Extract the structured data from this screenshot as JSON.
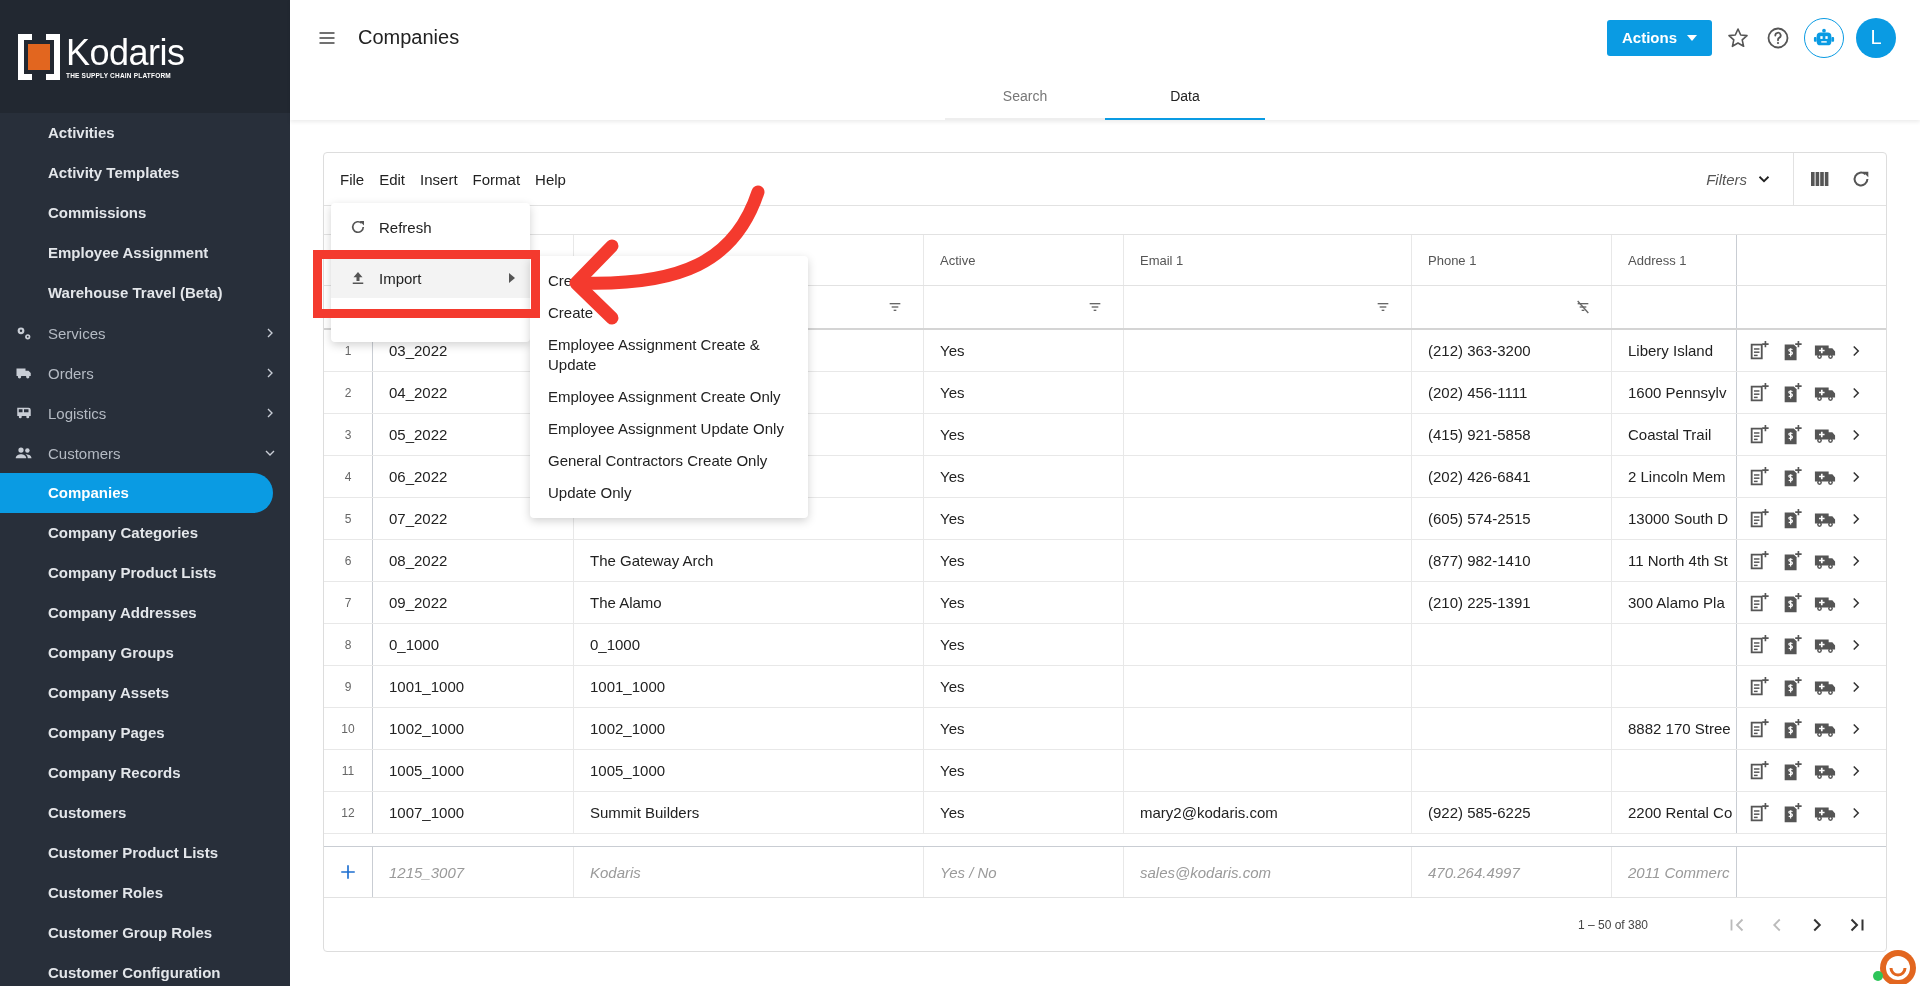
{
  "sidebar": {
    "logo": {
      "name": "Kodaris",
      "tagline": "THE SUPPLY CHAIN PLATFORM"
    },
    "items": [
      {
        "label": "Activities",
        "kind": "link",
        "selected": false
      },
      {
        "label": "Activity Templates",
        "kind": "link",
        "selected": false
      },
      {
        "label": "Commissions",
        "kind": "link",
        "selected": false
      },
      {
        "label": "Employee Assignment",
        "kind": "link",
        "selected": false
      },
      {
        "label": "Warehouse Travel (Beta)",
        "kind": "link",
        "selected": false
      },
      {
        "label": "Services",
        "kind": "group",
        "expanded": false
      },
      {
        "label": "Orders",
        "kind": "group",
        "expanded": false
      },
      {
        "label": "Logistics",
        "kind": "group",
        "expanded": false
      },
      {
        "label": "Customers",
        "kind": "group",
        "expanded": true
      },
      {
        "label": "Companies",
        "kind": "link",
        "selected": true
      },
      {
        "label": "Company Categories",
        "kind": "link",
        "selected": false
      },
      {
        "label": "Company Product Lists",
        "kind": "link",
        "selected": false
      },
      {
        "label": "Company Addresses",
        "kind": "link",
        "selected": false
      },
      {
        "label": "Company Groups",
        "kind": "link",
        "selected": false
      },
      {
        "label": "Company Assets",
        "kind": "link",
        "selected": false
      },
      {
        "label": "Company Pages",
        "kind": "link",
        "selected": false
      },
      {
        "label": "Company Records",
        "kind": "link",
        "selected": false
      },
      {
        "label": "Customers",
        "kind": "link",
        "selected": false
      },
      {
        "label": "Customer Product Lists",
        "kind": "link",
        "selected": false
      },
      {
        "label": "Customer Roles",
        "kind": "link",
        "selected": false
      },
      {
        "label": "Customer Group Roles",
        "kind": "link",
        "selected": false
      },
      {
        "label": "Customer Configuration",
        "kind": "link",
        "selected": false
      }
    ]
  },
  "header": {
    "title": "Companies",
    "actions_button": "Actions",
    "avatar": "L",
    "tabs": [
      {
        "label": "Search",
        "selected": false
      },
      {
        "label": "Data",
        "selected": true
      }
    ]
  },
  "toolbar": {
    "menus": [
      "File",
      "Edit",
      "Insert",
      "Format",
      "Help"
    ],
    "filters": "Filters"
  },
  "file_menu": {
    "items": [
      {
        "label": "Refresh",
        "kind": "refresh",
        "highlighted": false
      },
      {
        "label": "Import",
        "kind": "import",
        "highlighted": true
      }
    ]
  },
  "import_submenu": {
    "items": [
      "Cre",
      "Create",
      "Employee Assignment Create & Update",
      "Employee Assignment Create Only",
      "Employee Assignment Update Only",
      "General Contractors Create Only",
      "Update Only"
    ]
  },
  "table": {
    "columns": [
      {
        "filter": true,
        "filter_cleared": false
      },
      {
        "label": "Active",
        "filter": true,
        "filter_cleared": false
      },
      {
        "label": "Email 1",
        "filter": true,
        "filter_cleared": false
      },
      {
        "label": "Phone 1",
        "filter": true,
        "filter_cleared": true
      },
      {
        "label": "Address 1"
      }
    ],
    "rows": [
      {
        "number": "1",
        "code": "03_2022",
        "active": "Yes",
        "phone": "(212) 363-3200",
        "address": "Libery Island"
      },
      {
        "number": "2",
        "code": "04_2022",
        "active": "Yes",
        "phone": "(202) 456-1111",
        "address": "1600 Pennsylv"
      },
      {
        "number": "3",
        "code": "05_2022",
        "active": "Yes",
        "phone": "(415) 921-5858",
        "address": "Coastal Trail"
      },
      {
        "number": "4",
        "code": "06_2022",
        "active": "Yes",
        "phone": "(202) 426-6841",
        "address": "2 Lincoln Mem"
      },
      {
        "number": "5",
        "code": "07_2022",
        "active": "Yes",
        "phone": "(605) 574-2515",
        "address": "13000 South D"
      },
      {
        "number": "6",
        "code": "08_2022",
        "name": "The Gateway Arch",
        "active": "Yes",
        "phone": "(877) 982-1410",
        "address": "11 North 4th St"
      },
      {
        "number": "7",
        "code": "09_2022",
        "name": "The Alamo",
        "active": "Yes",
        "phone": "(210) 225-1391",
        "address": "300 Alamo Pla"
      },
      {
        "number": "8",
        "code": "0_1000",
        "name": "0_1000",
        "active": "Yes"
      },
      {
        "number": "9",
        "code": "1001_1000",
        "name": "1001_1000",
        "active": "Yes"
      },
      {
        "number": "10",
        "code": "1002_1000",
        "name": "1002_1000",
        "active": "Yes",
        "address": "8882 170 Stree"
      },
      {
        "number": "11",
        "code": "1005_1000",
        "name": "1005_1000",
        "active": "Yes"
      },
      {
        "number": "12",
        "code": "1007_1000",
        "name": "Summit Builders",
        "active": "Yes",
        "email": "mary2@kodaris.com",
        "phone": "(922) 585-6225",
        "address": "2200 Rental Co"
      }
    ],
    "new_row": {
      "placeholders": [
        "1215_3007",
        "Kodaris",
        "Yes / No",
        "sales@kodaris.com",
        "470.264.4997",
        "2011 Commerc"
      ]
    },
    "pagination": "1 – 50 of 380"
  }
}
